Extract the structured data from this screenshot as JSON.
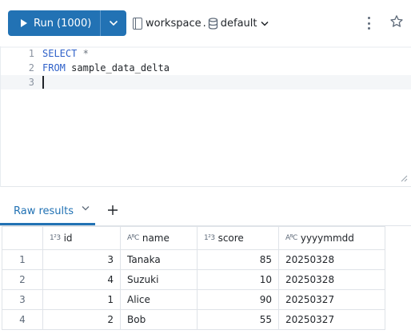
{
  "toolbar": {
    "run_label": "Run (1000)",
    "catalog": "workspace",
    "separator": ".",
    "schema": "default"
  },
  "editor": {
    "lines": [
      {
        "number": "1",
        "tokens": [
          "SELECT",
          " ",
          "*"
        ]
      },
      {
        "number": "2",
        "tokens": [
          "FROM",
          " ",
          "sample_data_delta"
        ]
      },
      {
        "number": "3",
        "tokens": []
      }
    ]
  },
  "results": {
    "tab_label": "Raw results",
    "columns": [
      {
        "label": "",
        "type_icon": ""
      },
      {
        "label": "id",
        "type_icon": "1²3"
      },
      {
        "label": "name",
        "type_icon": "AᴮC"
      },
      {
        "label": "score",
        "type_icon": "1²3"
      },
      {
        "label": "yyyymmdd",
        "type_icon": "AᴮC"
      }
    ],
    "rows": [
      {
        "row": "1",
        "id": "3",
        "name": "Tanaka",
        "score": "85",
        "yyyymmdd": "20250328"
      },
      {
        "row": "2",
        "id": "4",
        "name": "Suzuki",
        "score": "10",
        "yyyymmdd": "20250328"
      },
      {
        "row": "3",
        "id": "1",
        "name": "Alice",
        "score": "90",
        "yyyymmdd": "20250327"
      },
      {
        "row": "4",
        "id": "2",
        "name": "Bob",
        "score": "55",
        "yyyymmdd": "20250327"
      }
    ]
  },
  "colors": {
    "accent": "#2272b4",
    "keyword": "#2f61c9"
  }
}
